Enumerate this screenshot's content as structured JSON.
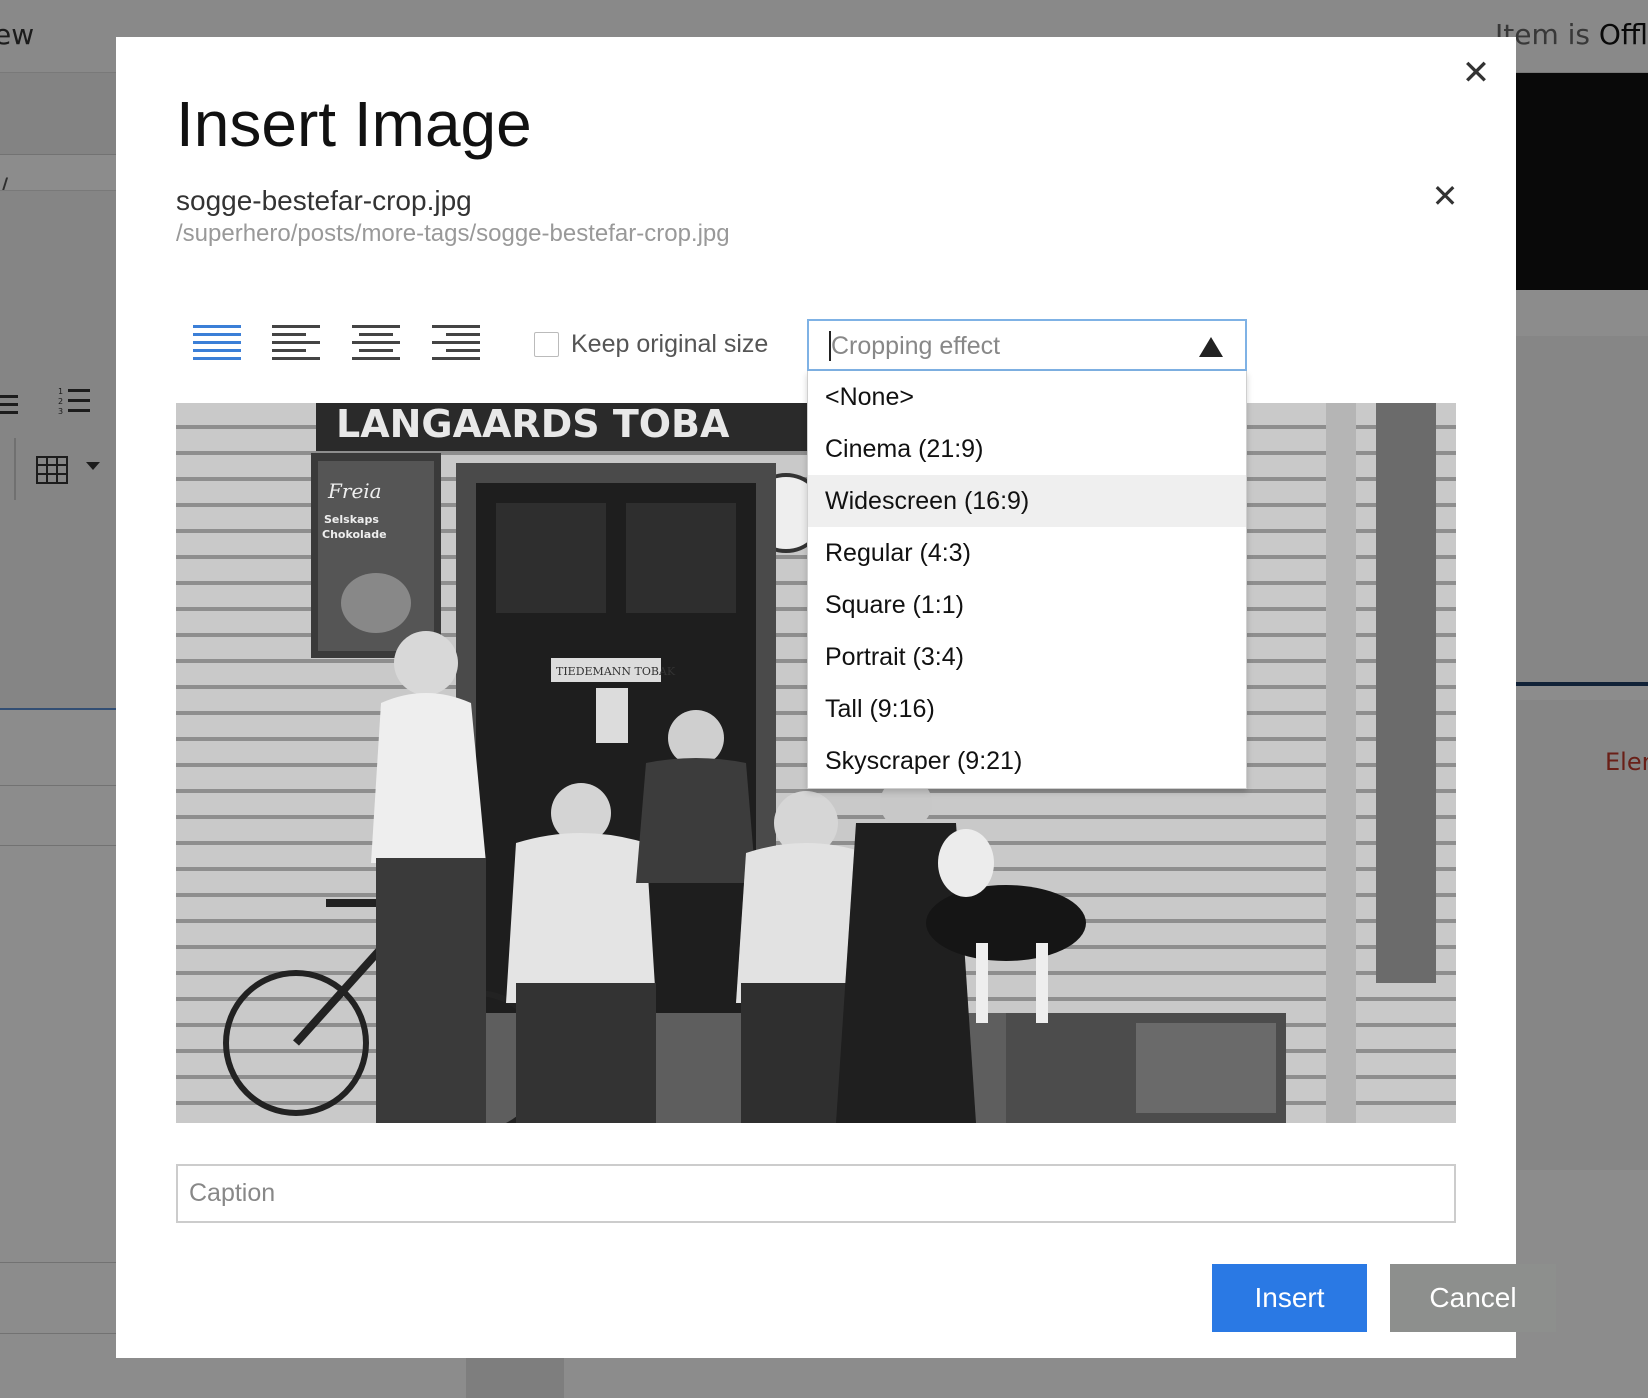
{
  "background": {
    "view_label": "ew",
    "status_prefix": "Item is ",
    "status_value": "Offl",
    "red_text": "Elen",
    "slash": "/",
    "olist_icon": "ordered-list-icon",
    "list_icon": "bullet-list-icon",
    "table_icon": "table-icon"
  },
  "modal": {
    "title": "Insert Image",
    "close_icon": "close-icon",
    "file": {
      "name": "sogge-bestefar-crop.jpg",
      "path": "/superhero/posts/more-tags/sogge-bestefar-crop.jpg",
      "remove_icon": "close-icon"
    },
    "alignment": [
      {
        "name": "align-full",
        "icon": "align-full-icon",
        "active": true
      },
      {
        "name": "align-left",
        "icon": "align-left-icon",
        "active": false
      },
      {
        "name": "align-center",
        "icon": "align-center-icon",
        "active": false
      },
      {
        "name": "align-right",
        "icon": "align-right-icon",
        "active": false
      }
    ],
    "keep_original_size": {
      "label": "Keep original size",
      "checked": false
    },
    "cropping": {
      "placeholder": "Cropping effect",
      "expanded": true,
      "options": [
        "<None>",
        "Cinema (21:9)",
        "Widescreen (16:9)",
        "Regular (4:3)",
        "Square (1:1)",
        "Portrait (3:4)",
        "Tall (9:16)",
        "Skyscraper (9:21)"
      ],
      "hovered_option": "Widescreen (16:9)"
    },
    "preview": {
      "sign_text": "LANGAARDS TOBA",
      "poster_text": "Freia Selskaps Chokolade",
      "door_sign": "TIEDEMANN TOBAK"
    },
    "caption": {
      "placeholder": "Caption",
      "value": ""
    },
    "buttons": {
      "insert": "Insert",
      "cancel": "Cancel"
    }
  },
  "colors": {
    "accent": "#2a79e4",
    "cancel": "#8d8f8d",
    "focus_border": "#7fb2e5",
    "active_align": "#3b7fd7"
  }
}
